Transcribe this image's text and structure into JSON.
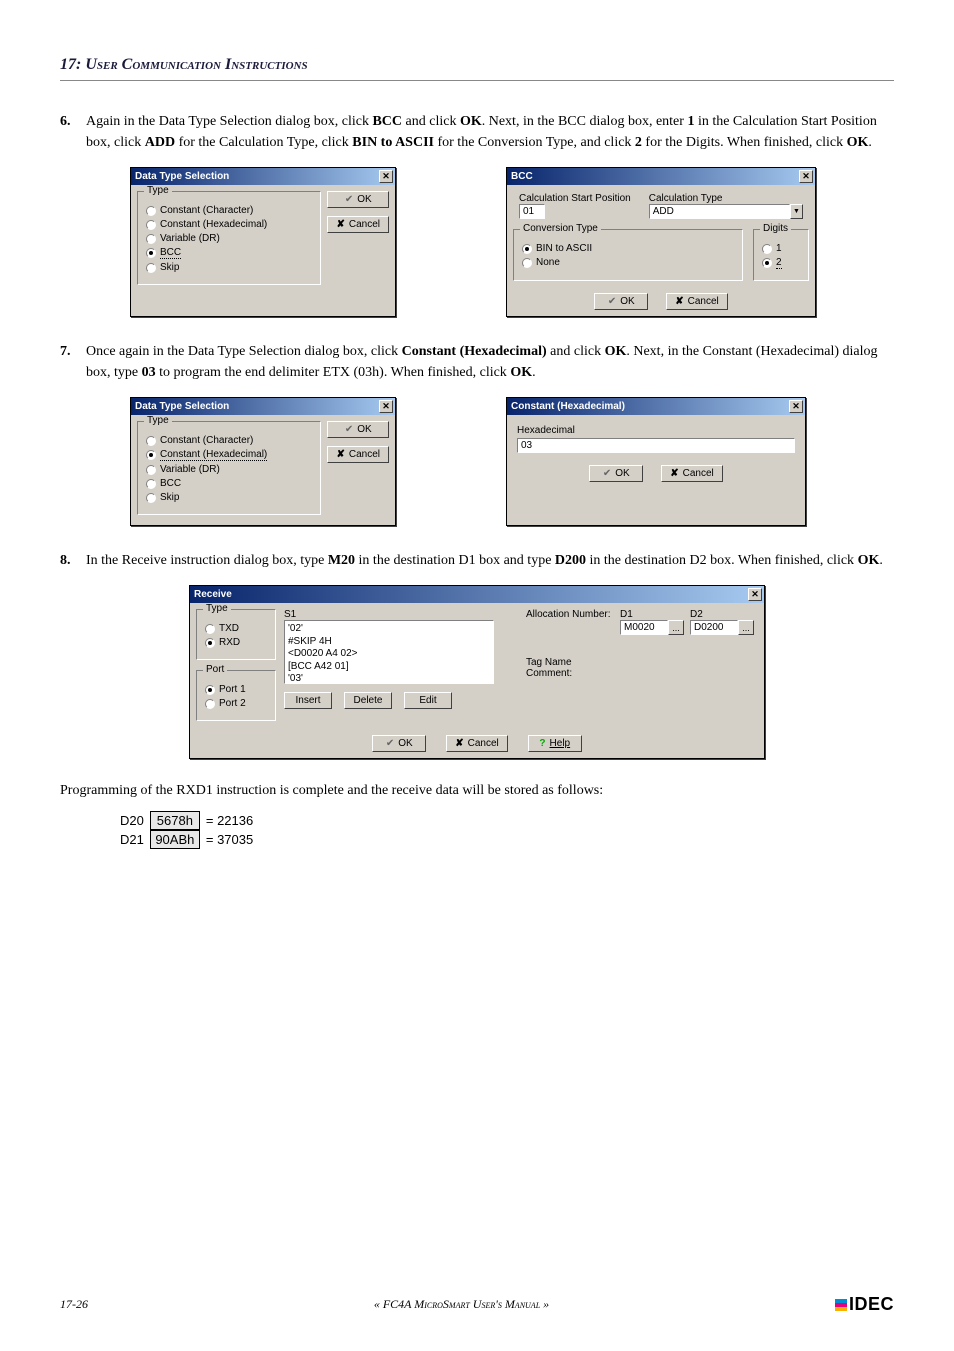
{
  "chapter": "17: User Communication Instructions",
  "steps": {
    "s6": {
      "num": "6.",
      "text_a": "Again in the Data Type Selection dialog box, click ",
      "b1": "BCC",
      "t2": " and click ",
      "b2": "OK",
      "t3": ". Next, in the BCC dialog box, enter ",
      "b3": "1",
      "t4": " in the Calculation Start Position box, click ",
      "b4": "ADD",
      "t5": " for the Calculation Type, click ",
      "b5": "BIN to ASCII",
      "t6": " for the Conversion Type, and click ",
      "b6": "2",
      "t7": " for the Digits. When finished, click ",
      "b7": "OK",
      "t8": "."
    },
    "s7": {
      "num": "7.",
      "t1": "Once again in the Data Type Selection dialog box, click ",
      "b1": "Constant (Hexadecimal)",
      "t2": " and click ",
      "b2": "OK",
      "t3": ". Next, in the Constant (Hexadecimal) dialog box, type ",
      "b3": "03",
      "t4": " to program the end delimiter ETX (03h). When finished, click ",
      "b4": "OK",
      "t5": "."
    },
    "s8": {
      "num": "8.",
      "t1": "In the Receive instruction dialog box, type ",
      "b1": "M20",
      "t2": " in the destination D1 box and type ",
      "b2": "D200",
      "t3": " in the destination D2 box. When finished, click ",
      "b3": "OK",
      "t4": "."
    }
  },
  "dlg_dts_a": {
    "title": "Data Type Selection",
    "legend": "Type",
    "r1": "Constant (Character)",
    "r2": "Constant (Hexadecimal)",
    "r3": "Variable (DR)",
    "r4": "BCC",
    "r5": "Skip",
    "ok": "OK",
    "cancel": "Cancel"
  },
  "dlg_bcc": {
    "title": "BCC",
    "csp_label": "Calculation Start Position",
    "csp_value": "01",
    "ct_label": "Calculation Type",
    "ct_value": "ADD",
    "conv_legend": "Conversion Type",
    "conv1": "BIN to ASCII",
    "conv2": "None",
    "digits_legend": "Digits",
    "d1": "1",
    "d2": "2",
    "ok": "OK",
    "cancel": "Cancel"
  },
  "dlg_dts_b": {
    "title": "Data Type Selection",
    "legend": "Type",
    "r1": "Constant (Character)",
    "r2": "Constant (Hexadecimal)",
    "r3": "Variable (DR)",
    "r4": "BCC",
    "r5": "Skip",
    "ok": "OK",
    "cancel": "Cancel"
  },
  "dlg_ch": {
    "title": "Constant (Hexadecimal)",
    "label": "Hexadecimal",
    "value": "03",
    "ok": "OK",
    "cancel": "Cancel"
  },
  "dlg_rcv": {
    "title": "Receive",
    "type_legend": "Type",
    "type_txd": "TXD",
    "type_rxd": "RXD",
    "port_legend": "Port",
    "port1": "Port 1",
    "port2": "Port 2",
    "s1": "S1",
    "list": "'02'\n#SKIP 4H\n<D0020 A4 02>\n[BCC A42 01]\n'03'",
    "insert": "Insert",
    "delete": "Delete",
    "edit": "Edit",
    "alloc": "Allocation Number:",
    "tagc": "Tag Name Comment:",
    "d1": "D1",
    "d1v": "M0020",
    "d2": "D2",
    "d2v": "D0200",
    "dots": "...",
    "ok": "OK",
    "cancel": "Cancel",
    "help": "Help"
  },
  "tail": "Programming of the RXD1 instruction is complete and the receive data will be stored as follows:",
  "store": {
    "r1name": "D20",
    "r1val": "5678h",
    "r1dec": "= 22136",
    "r2name": "D21",
    "r2val": "90ABh",
    "r2dec": "= 37035"
  },
  "footer": {
    "page": "17-26",
    "manual": "« FC4A MicroSmart User's Manual »",
    "brand": "IDEC"
  },
  "icons": {
    "check": "✔",
    "x": "✘",
    "q": "?",
    "down": "▼",
    "close": "✕"
  }
}
